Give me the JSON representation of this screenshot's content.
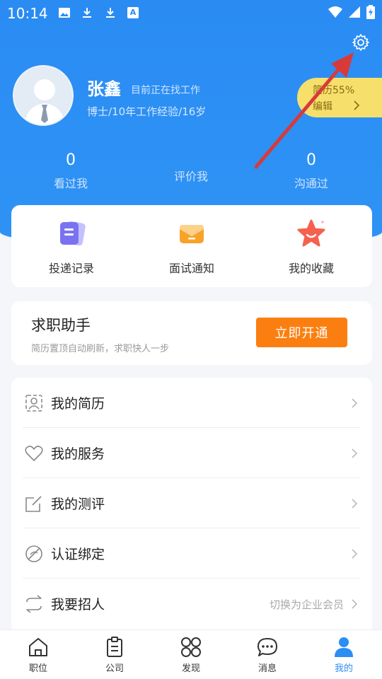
{
  "status_bar": {
    "time": "10:14",
    "notif_letter": "A"
  },
  "profile": {
    "name": "张鑫",
    "job_status": "目前正在找工作",
    "meta": "博士/10年工作经验/16岁",
    "resume_percent": "简历55%",
    "resume_edit": "编辑"
  },
  "stats": [
    {
      "value": "0",
      "label": "看过我"
    },
    {
      "value": "",
      "label": "评价我"
    },
    {
      "value": "0",
      "label": "沟通过"
    }
  ],
  "quick_actions": [
    {
      "label": "投递记录",
      "icon": "document-stack-icon"
    },
    {
      "label": "面试通知",
      "icon": "envelope-icon"
    },
    {
      "label": "我的收藏",
      "icon": "star-icon"
    }
  ],
  "assistant": {
    "title": "求职助手",
    "subtitle": "简历置顶自动刷新，求职快人一步",
    "button": "立即开通"
  },
  "menu": [
    {
      "label": "我的简历",
      "icon": "resume-icon",
      "hint": ""
    },
    {
      "label": "我的服务",
      "icon": "heart-icon",
      "hint": ""
    },
    {
      "label": "我的测评",
      "icon": "edit-icon",
      "hint": ""
    },
    {
      "label": "认证绑定",
      "icon": "verify-icon",
      "hint": ""
    },
    {
      "label": "我要招人",
      "icon": "switch-icon",
      "hint": "切换为企业会员"
    }
  ],
  "tabs": [
    {
      "label": "职位",
      "icon": "home-icon",
      "active": false
    },
    {
      "label": "公司",
      "icon": "clipboard-icon",
      "active": false
    },
    {
      "label": "发现",
      "icon": "grid-icon",
      "active": false
    },
    {
      "label": "消息",
      "icon": "chat-icon",
      "active": false
    },
    {
      "label": "我的",
      "icon": "person-icon",
      "active": true
    }
  ],
  "colors": {
    "primary": "#2b8ef3",
    "accent": "#fb7f10",
    "badge": "#f6df6b",
    "arrow": "#d83a3a"
  }
}
